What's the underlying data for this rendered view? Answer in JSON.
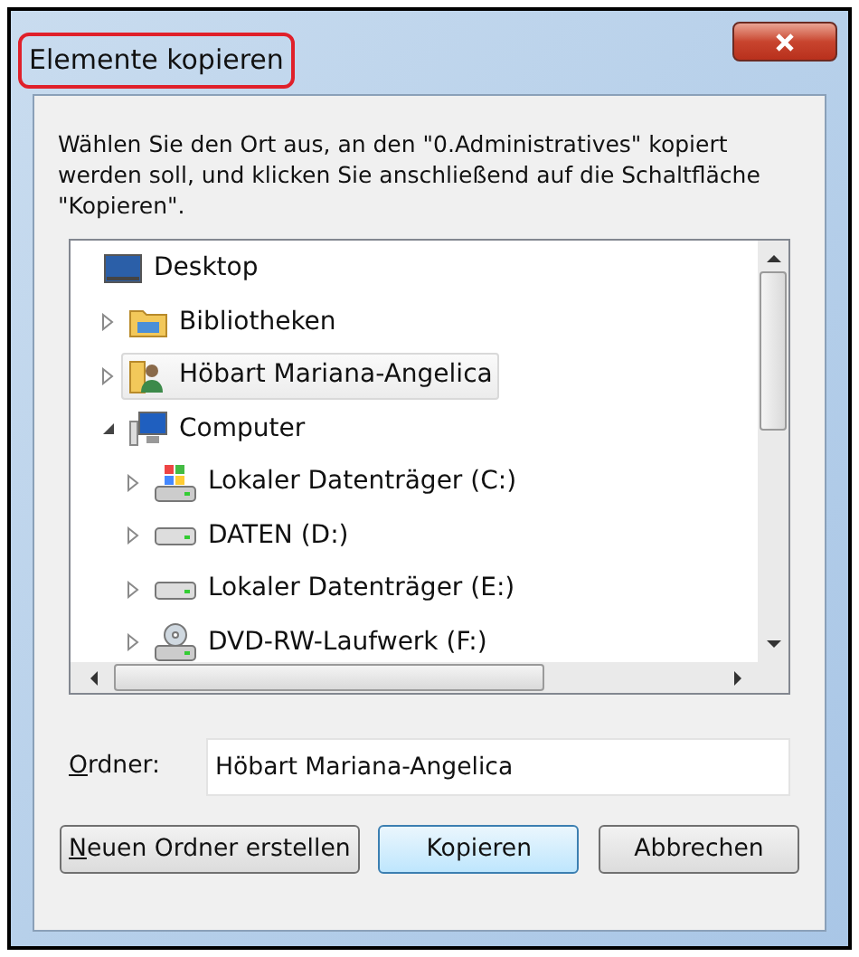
{
  "window": {
    "title": "Elemente kopieren",
    "title_highlighted": true
  },
  "instructions": "Wählen Sie den Ort aus, an den \"0.Administratives\" kopiert werden soll, und klicken Sie anschließend auf die Schaltfläche \"Kopieren\".",
  "tree": [
    {
      "label": "Desktop",
      "kind": "desktop",
      "selected": false
    },
    {
      "label": "Bibliotheken",
      "kind": "library",
      "expandable": true,
      "expanded": false,
      "selected": false
    },
    {
      "label": "Höbart Mariana-Angelica",
      "kind": "user-folder",
      "expandable": true,
      "expanded": false,
      "selected": true
    },
    {
      "label": "Computer",
      "kind": "computer",
      "expandable": true,
      "expanded": true,
      "selected": false,
      "children": [
        {
          "label": "Lokaler Datenträger (C:)",
          "kind": "system-drive",
          "expandable": true,
          "expanded": false,
          "selected": false
        },
        {
          "label": "DATEN (D:)",
          "kind": "drive",
          "expandable": true,
          "expanded": false,
          "selected": false
        },
        {
          "label": "Lokaler Datenträger (E:)",
          "kind": "drive",
          "expandable": true,
          "expanded": false,
          "selected": false
        },
        {
          "label": "DVD-RW-Laufwerk (F:)",
          "kind": "dvd-drive",
          "expandable": true,
          "expanded": false,
          "selected": false
        }
      ]
    }
  ],
  "folder_field": {
    "label": "Ordner:",
    "value": "Höbart Mariana-Angelica"
  },
  "buttons": [
    {
      "label": "Neuen Ordner erstellen",
      "default": false
    },
    {
      "label": "Kopieren",
      "default": true
    },
    {
      "label": "Abbrechen",
      "default": false
    }
  ]
}
